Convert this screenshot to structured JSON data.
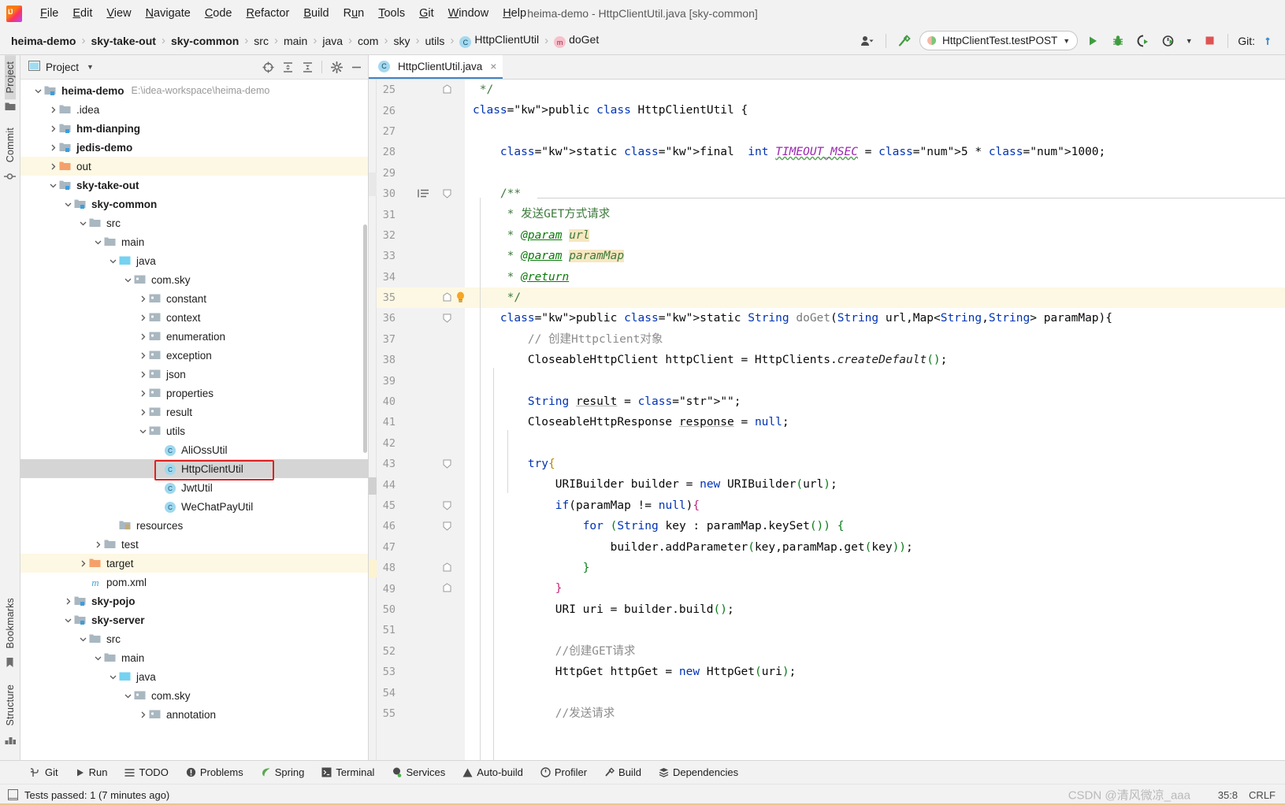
{
  "window": {
    "title": "heima-demo - HttpClientUtil.java [sky-common]"
  },
  "menubar": {
    "items": [
      "File",
      "Edit",
      "View",
      "Navigate",
      "Code",
      "Refactor",
      "Build",
      "Run",
      "Tools",
      "Git",
      "Window",
      "Help"
    ]
  },
  "navbar": {
    "breadcrumbs": [
      {
        "label": "heima-demo",
        "bold": true,
        "icon": ""
      },
      {
        "label": "sky-take-out",
        "bold": true,
        "icon": ""
      },
      {
        "label": "sky-common",
        "bold": true,
        "icon": ""
      },
      {
        "label": "src",
        "bold": false,
        "icon": ""
      },
      {
        "label": "main",
        "bold": false,
        "icon": ""
      },
      {
        "label": "java",
        "bold": false,
        "icon": ""
      },
      {
        "label": "com",
        "bold": false,
        "icon": ""
      },
      {
        "label": "sky",
        "bold": false,
        "icon": ""
      },
      {
        "label": "utils",
        "bold": false,
        "icon": ""
      },
      {
        "label": "HttpClientUtil",
        "bold": false,
        "icon": "class-icon"
      },
      {
        "label": "doGet",
        "bold": false,
        "icon": "method-icon"
      }
    ],
    "run_configuration": "HttpClientTest.testPOST",
    "git_label": "Git:",
    "icons": {
      "user": "user-icon",
      "hammer": "build-hammer-icon",
      "run": "run-icon",
      "debug": "debug-icon",
      "coverage": "run-with-coverage-icon",
      "profile": "profiler-icon",
      "stop": "stop-icon"
    }
  },
  "rail": {
    "top": [
      {
        "label": "Project",
        "icon": "project-folder-icon",
        "active": true
      },
      {
        "label": "Commit",
        "icon": "commit-icon",
        "active": false
      }
    ],
    "bottom": [
      {
        "label": "Bookmarks",
        "icon": "bookmark-icon",
        "active": false
      },
      {
        "label": "Structure",
        "icon": "structure-icon",
        "active": false
      }
    ]
  },
  "project_panel": {
    "title": "Project",
    "icons": [
      "select-opened-file-icon",
      "expand-all-icon",
      "collapse-all-icon",
      "settings-gear-icon",
      "hide-icon"
    ],
    "tree": [
      {
        "depth": 0,
        "label": "heima-demo",
        "bold": true,
        "arrow": "down",
        "icon": "module-folder",
        "path": "E:\\idea-workspace\\heima-demo",
        "state": "none"
      },
      {
        "depth": 1,
        "label": ".idea",
        "bold": false,
        "arrow": "right",
        "icon": "folder",
        "path": "",
        "state": "none"
      },
      {
        "depth": 1,
        "label": "hm-dianping",
        "bold": true,
        "arrow": "right",
        "icon": "module-folder",
        "path": "",
        "state": "none"
      },
      {
        "depth": 1,
        "label": "jedis-demo",
        "bold": true,
        "arrow": "right",
        "icon": "module-folder",
        "path": "",
        "state": "none"
      },
      {
        "depth": 1,
        "label": "out",
        "bold": false,
        "arrow": "right",
        "icon": "excluded-folder",
        "path": "",
        "state": "yellow"
      },
      {
        "depth": 1,
        "label": "sky-take-out",
        "bold": true,
        "arrow": "down",
        "icon": "module-folder",
        "path": "",
        "state": "none"
      },
      {
        "depth": 2,
        "label": "sky-common",
        "bold": true,
        "arrow": "down",
        "icon": "module-folder",
        "path": "",
        "state": "none"
      },
      {
        "depth": 3,
        "label": "src",
        "bold": false,
        "arrow": "down",
        "icon": "folder",
        "path": "",
        "state": "none"
      },
      {
        "depth": 4,
        "label": "main",
        "bold": false,
        "arrow": "down",
        "icon": "folder",
        "path": "",
        "state": "none"
      },
      {
        "depth": 5,
        "label": "java",
        "bold": false,
        "arrow": "down",
        "icon": "source-folder",
        "path": "",
        "state": "none"
      },
      {
        "depth": 6,
        "label": "com.sky",
        "bold": false,
        "arrow": "down",
        "icon": "package",
        "path": "",
        "state": "none"
      },
      {
        "depth": 7,
        "label": "constant",
        "bold": false,
        "arrow": "right",
        "icon": "package",
        "path": "",
        "state": "none"
      },
      {
        "depth": 7,
        "label": "context",
        "bold": false,
        "arrow": "right",
        "icon": "package",
        "path": "",
        "state": "none"
      },
      {
        "depth": 7,
        "label": "enumeration",
        "bold": false,
        "arrow": "right",
        "icon": "package",
        "path": "",
        "state": "none"
      },
      {
        "depth": 7,
        "label": "exception",
        "bold": false,
        "arrow": "right",
        "icon": "package",
        "path": "",
        "state": "none"
      },
      {
        "depth": 7,
        "label": "json",
        "bold": false,
        "arrow": "right",
        "icon": "package",
        "path": "",
        "state": "none"
      },
      {
        "depth": 7,
        "label": "properties",
        "bold": false,
        "arrow": "right",
        "icon": "package",
        "path": "",
        "state": "none"
      },
      {
        "depth": 7,
        "label": "result",
        "bold": false,
        "arrow": "right",
        "icon": "package",
        "path": "",
        "state": "none"
      },
      {
        "depth": 7,
        "label": "utils",
        "bold": false,
        "arrow": "down",
        "icon": "package",
        "path": "",
        "state": "none"
      },
      {
        "depth": 8,
        "label": "AliOssUtil",
        "bold": false,
        "arrow": "none",
        "icon": "java-class",
        "path": "",
        "state": "none"
      },
      {
        "depth": 8,
        "label": "HttpClientUtil",
        "bold": false,
        "arrow": "none",
        "icon": "java-class",
        "path": "",
        "state": "selected"
      },
      {
        "depth": 8,
        "label": "JwtUtil",
        "bold": false,
        "arrow": "none",
        "icon": "java-class",
        "path": "",
        "state": "none"
      },
      {
        "depth": 8,
        "label": "WeChatPayUtil",
        "bold": false,
        "arrow": "none",
        "icon": "java-class",
        "path": "",
        "state": "none"
      },
      {
        "depth": 5,
        "label": "resources",
        "bold": false,
        "arrow": "none",
        "icon": "resource-folder",
        "path": "",
        "state": "none"
      },
      {
        "depth": 4,
        "label": "test",
        "bold": false,
        "arrow": "right",
        "icon": "folder",
        "path": "",
        "state": "none"
      },
      {
        "depth": 3,
        "label": "target",
        "bold": false,
        "arrow": "right",
        "icon": "excluded-folder",
        "path": "",
        "state": "yellow"
      },
      {
        "depth": 3,
        "label": "pom.xml",
        "bold": false,
        "arrow": "none",
        "icon": "maven-file",
        "path": "",
        "state": "none"
      },
      {
        "depth": 2,
        "label": "sky-pojo",
        "bold": true,
        "arrow": "right",
        "icon": "module-folder",
        "path": "",
        "state": "none"
      },
      {
        "depth": 2,
        "label": "sky-server",
        "bold": true,
        "arrow": "down",
        "icon": "module-folder",
        "path": "",
        "state": "none"
      },
      {
        "depth": 3,
        "label": "src",
        "bold": false,
        "arrow": "down",
        "icon": "folder",
        "path": "",
        "state": "none"
      },
      {
        "depth": 4,
        "label": "main",
        "bold": false,
        "arrow": "down",
        "icon": "folder",
        "path": "",
        "state": "none"
      },
      {
        "depth": 5,
        "label": "java",
        "bold": false,
        "arrow": "down",
        "icon": "source-folder",
        "path": "",
        "state": "none"
      },
      {
        "depth": 6,
        "label": "com.sky",
        "bold": false,
        "arrow": "down",
        "icon": "package",
        "path": "",
        "state": "none"
      },
      {
        "depth": 7,
        "label": "annotation",
        "bold": false,
        "arrow": "right",
        "icon": "package",
        "path": "",
        "state": "none"
      }
    ]
  },
  "editor": {
    "tab": {
      "label": "HttpClientUtil.java",
      "icon": "java-class-icon",
      "close": "×"
    },
    "first_line": 25,
    "current_line": 35,
    "lines": [
      {
        "n": 25,
        "fold": "end",
        "text": " */"
      },
      {
        "n": 26,
        "fold": "",
        "text": "public class HttpClientUtil {"
      },
      {
        "n": 27,
        "fold": "",
        "text": ""
      },
      {
        "n": 28,
        "fold": "",
        "text": "    static final  int TIMEOUT_MSEC = 5 * 1000;"
      },
      {
        "n": 29,
        "fold": "",
        "text": ""
      },
      {
        "n": 30,
        "fold": "start",
        "text": "    /**"
      },
      {
        "n": 31,
        "fold": "",
        "text": "     * 发送GET方式请求"
      },
      {
        "n": 32,
        "fold": "",
        "text": "     * @param url"
      },
      {
        "n": 33,
        "fold": "",
        "text": "     * @param paramMap"
      },
      {
        "n": 34,
        "fold": "",
        "text": "     * @return"
      },
      {
        "n": 35,
        "fold": "end",
        "text": "     */"
      },
      {
        "n": 36,
        "fold": "start",
        "text": "    public static String doGet(String url,Map<String,String> paramMap){"
      },
      {
        "n": 37,
        "fold": "",
        "text": "        // 创建Httpclient对象"
      },
      {
        "n": 38,
        "fold": "",
        "text": "        CloseableHttpClient httpClient = HttpClients.createDefault();"
      },
      {
        "n": 39,
        "fold": "",
        "text": ""
      },
      {
        "n": 40,
        "fold": "",
        "text": "        String result = \"\";"
      },
      {
        "n": 41,
        "fold": "",
        "text": "        CloseableHttpResponse response = null;"
      },
      {
        "n": 42,
        "fold": "",
        "text": ""
      },
      {
        "n": 43,
        "fold": "start",
        "text": "        try{"
      },
      {
        "n": 44,
        "fold": "",
        "text": "            URIBuilder builder = new URIBuilder(url);"
      },
      {
        "n": 45,
        "fold": "start",
        "text": "            if(paramMap != null){"
      },
      {
        "n": 46,
        "fold": "start",
        "text": "                for (String key : paramMap.keySet()) {"
      },
      {
        "n": 47,
        "fold": "",
        "text": "                    builder.addParameter(key,paramMap.get(key));"
      },
      {
        "n": 48,
        "fold": "end",
        "text": "                }"
      },
      {
        "n": 49,
        "fold": "end",
        "text": "            }"
      },
      {
        "n": 50,
        "fold": "",
        "text": "            URI uri = builder.build();"
      },
      {
        "n": 51,
        "fold": "",
        "text": ""
      },
      {
        "n": 52,
        "fold": "",
        "text": "            //创建GET请求"
      },
      {
        "n": 53,
        "fold": "",
        "text": "            HttpGet httpGet = new HttpGet(uri);"
      },
      {
        "n": 54,
        "fold": "",
        "text": ""
      },
      {
        "n": 55,
        "fold": "",
        "text": "            //发送请求"
      }
    ]
  },
  "toolwindow_bar": {
    "items": [
      {
        "label": "Git",
        "icon": "git-branch-icon"
      },
      {
        "label": "Run",
        "icon": "run-icon"
      },
      {
        "label": "TODO",
        "icon": "todo-list-icon"
      },
      {
        "label": "Problems",
        "icon": "problems-icon"
      },
      {
        "label": "Spring",
        "icon": "spring-leaf-icon"
      },
      {
        "label": "Terminal",
        "icon": "terminal-icon"
      },
      {
        "label": "Services",
        "icon": "services-icon"
      },
      {
        "label": "Auto-build",
        "icon": "warning-triangle-icon"
      },
      {
        "label": "Profiler",
        "icon": "profiler-icon"
      },
      {
        "label": "Build",
        "icon": "build-hammer-icon"
      },
      {
        "label": "Dependencies",
        "icon": "dependencies-icon"
      }
    ]
  },
  "statusbar": {
    "message": "Tests passed: 1 (7 minutes ago)",
    "icon": "status-console-icon",
    "caret": "35:8",
    "line_separator": "CRLF",
    "watermark": "CSDN @清风微凉_aaa"
  },
  "colors": {
    "accent": "#4083c9",
    "selection": "#d5d5d5",
    "highlight_row": "#fdf8e3",
    "red_box": "#e02020",
    "keyword": "#0033b3",
    "string": "#067d17",
    "comment": "#8c8c8c",
    "javadoc": "#3d7a3d",
    "static_field": "#9c27b0",
    "number": "#1750eb"
  }
}
